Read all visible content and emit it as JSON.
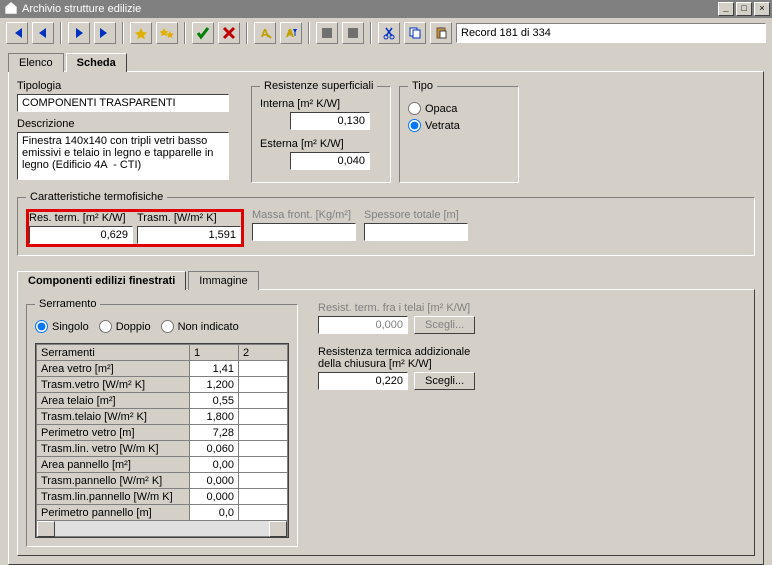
{
  "titlebar": {
    "title": "Archivio strutture edilizie"
  },
  "toolbar": {
    "record": "Record 181 di 334"
  },
  "tabs": {
    "elenco": "Elenco",
    "scheda": "Scheda"
  },
  "tipologia": {
    "label": "Tipologia",
    "value": "COMPONENTI TRASPARENTI",
    "desc_label": "Descrizione",
    "desc_value": "Finestra 140x140 con tripli vetri basso emissivi e telaio in legno e tapparelle in legno (Edificio 4A  - CTI)"
  },
  "resistenze": {
    "legend": "Resistenze superficiali",
    "interna_label": "Interna [m² K/W]",
    "interna_val": "0,130",
    "esterna_label": "Esterna  [m² K/W]",
    "esterna_val": "0,040"
  },
  "tipo": {
    "legend": "Tipo",
    "opaca": "Opaca",
    "vetrata": "Vetrata"
  },
  "caratt": {
    "legend": "Caratteristiche termofisiche",
    "res_label": "Res. term. [m² K/W]",
    "res_val": "0,629",
    "trasm_label": "Trasm. [W/m² K]",
    "trasm_val": "1,591",
    "massa_label": "Massa front. [Kg/m²]",
    "massa_val": "",
    "spess_label": "Spessore totale [m]",
    "spess_val": ""
  },
  "subtabs": {
    "comp": "Componenti edilizi finestrati",
    "img": "Immagine"
  },
  "serramento": {
    "legend": "Serramento",
    "singolo": "Singolo",
    "doppio": "Doppio",
    "non_ind": "Non indicato",
    "headers": {
      "c0": "Serramenti",
      "c1": "1",
      "c2": "2"
    },
    "rows": [
      {
        "label": "Area vetro [m²]",
        "v1": "1,41",
        "v2": ""
      },
      {
        "label": "Trasm.vetro [W/m² K]",
        "v1": "1,200",
        "v2": ""
      },
      {
        "label": "Area telaio [m²]",
        "v1": "0,55",
        "v2": ""
      },
      {
        "label": "Trasm.telaio [W/m² K]",
        "v1": "1,800",
        "v2": ""
      },
      {
        "label": "Perimetro vetro [m]",
        "v1": "7,28",
        "v2": ""
      },
      {
        "label": "Trasm.lin. vetro [W/m K]",
        "v1": "0,060",
        "v2": ""
      },
      {
        "label": "Area pannello [m²]",
        "v1": "0,00",
        "v2": ""
      },
      {
        "label": "Trasm.pannello [W/m² K]",
        "v1": "0,000",
        "v2": ""
      },
      {
        "label": "Trasm.lin.pannello [W/m K]",
        "v1": "0,000",
        "v2": ""
      },
      {
        "label": "Perimetro pannello [m]",
        "v1": "0,0",
        "v2": ""
      }
    ]
  },
  "rightcol": {
    "resist_telai_label": "Resist. term. fra i telai [m² K/W]",
    "resist_telai_val": "0,000",
    "scegli": "Scegli...",
    "resist_chiusura_label": "Resistenza termica addizionale della chiusura [m² K/W]",
    "resist_chiusura_val": "0,220"
  }
}
